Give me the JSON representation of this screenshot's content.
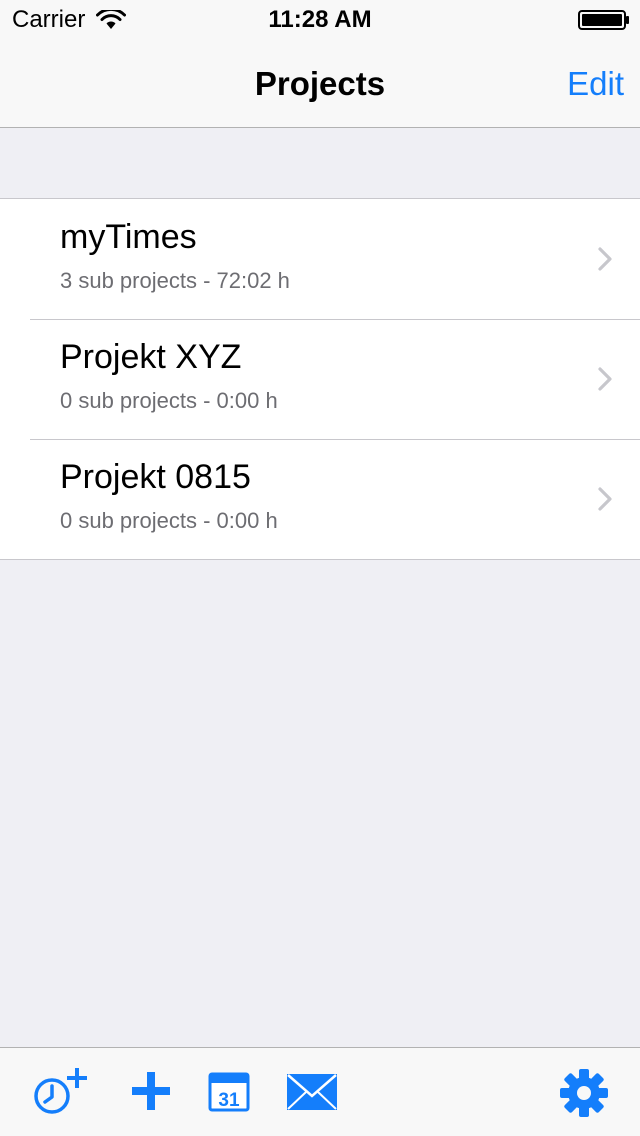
{
  "status_bar": {
    "carrier": "Carrier",
    "time": "11:28 AM",
    "wifi_icon": "wifi-icon",
    "battery_icon": "battery-icon"
  },
  "nav": {
    "title": "Projects",
    "edit_label": "Edit"
  },
  "projects": [
    {
      "title": "myTimes",
      "subtitle": "3 sub projects - 72:02 h"
    },
    {
      "title": "Projekt XYZ",
      "subtitle": "0 sub projects - 0:00 h"
    },
    {
      "title": "Projekt 0815",
      "subtitle": "0 sub projects - 0:00 h"
    }
  ],
  "toolbar": {
    "items": [
      {
        "icon": "clock-plus-icon"
      },
      {
        "icon": "plus-icon"
      },
      {
        "icon": "calendar-icon",
        "calendar_day": "31"
      },
      {
        "icon": "mail-icon"
      },
      {
        "icon": "gear-icon"
      }
    ]
  },
  "colors": {
    "accent": "#147efb",
    "background": "#efeff4",
    "subtitle": "#6d6d72",
    "separator": "#c8c7cc"
  }
}
